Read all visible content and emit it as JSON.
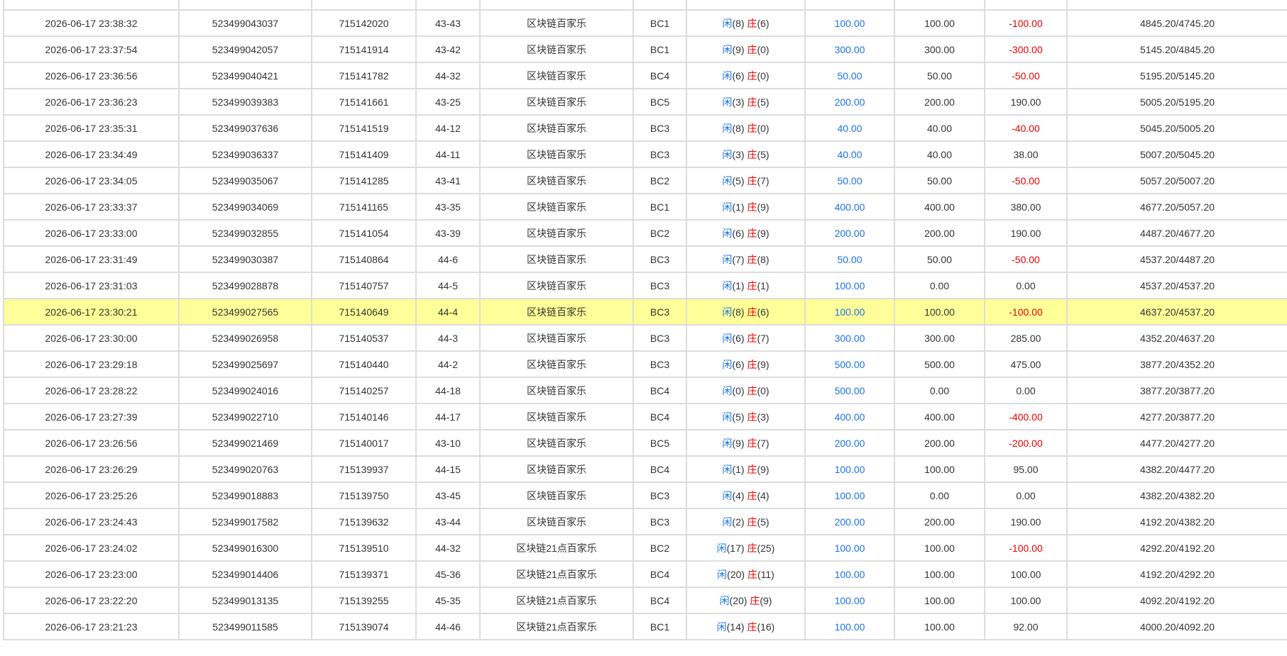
{
  "colors": {
    "player": "#1a73e8",
    "banker": "#e60000",
    "bet_amount": "#1a73e8",
    "negative": "#e60000",
    "highlight_row": "#ffff99",
    "grid": "#dcdcdc"
  },
  "labels": {
    "player": "闲",
    "banker": "庄"
  },
  "rows": [
    {
      "time": "",
      "order_no": "",
      "round_no": "",
      "shoe": "",
      "game": "",
      "table": "",
      "player_pts": "",
      "banker_pts": "",
      "bet": "",
      "valid": "",
      "win": "",
      "balance": "",
      "neg": false,
      "highlight": false,
      "partial": true
    },
    {
      "time": "2026-06-17 23:38:32",
      "order_no": "523499043037",
      "round_no": "715142020",
      "shoe": "43-43",
      "game": "区块链百家乐",
      "table": "BC1",
      "player_pts": "(8)",
      "banker_pts": "(6)",
      "bet": "100.00",
      "valid": "100.00",
      "win": "-100.00",
      "balance": "4845.20/4745.20",
      "neg": true,
      "highlight": false
    },
    {
      "time": "2026-06-17 23:37:54",
      "order_no": "523499042057",
      "round_no": "715141914",
      "shoe": "43-42",
      "game": "区块链百家乐",
      "table": "BC1",
      "player_pts": "(9)",
      "banker_pts": "(0)",
      "bet": "300.00",
      "valid": "300.00",
      "win": "-300.00",
      "balance": "5145.20/4845.20",
      "neg": true,
      "highlight": false
    },
    {
      "time": "2026-06-17 23:36:56",
      "order_no": "523499040421",
      "round_no": "715141782",
      "shoe": "44-32",
      "game": "区块链百家乐",
      "table": "BC4",
      "player_pts": "(6)",
      "banker_pts": "(0)",
      "bet": "50.00",
      "valid": "50.00",
      "win": "-50.00",
      "balance": "5195.20/5145.20",
      "neg": true,
      "highlight": false
    },
    {
      "time": "2026-06-17 23:36:23",
      "order_no": "523499039383",
      "round_no": "715141661",
      "shoe": "43-25",
      "game": "区块链百家乐",
      "table": "BC5",
      "player_pts": "(3)",
      "banker_pts": "(5)",
      "bet": "200.00",
      "valid": "200.00",
      "win": "190.00",
      "balance": "5005.20/5195.20",
      "neg": false,
      "highlight": false
    },
    {
      "time": "2026-06-17 23:35:31",
      "order_no": "523499037636",
      "round_no": "715141519",
      "shoe": "44-12",
      "game": "区块链百家乐",
      "table": "BC3",
      "player_pts": "(8)",
      "banker_pts": "(0)",
      "bet": "40.00",
      "valid": "40.00",
      "win": "-40.00",
      "balance": "5045.20/5005.20",
      "neg": true,
      "highlight": false
    },
    {
      "time": "2026-06-17 23:34:49",
      "order_no": "523499036337",
      "round_no": "715141409",
      "shoe": "44-11",
      "game": "区块链百家乐",
      "table": "BC3",
      "player_pts": "(3)",
      "banker_pts": "(5)",
      "bet": "40.00",
      "valid": "40.00",
      "win": "38.00",
      "balance": "5007.20/5045.20",
      "neg": false,
      "highlight": false
    },
    {
      "time": "2026-06-17 23:34:05",
      "order_no": "523499035067",
      "round_no": "715141285",
      "shoe": "43-41",
      "game": "区块链百家乐",
      "table": "BC2",
      "player_pts": "(5)",
      "banker_pts": "(7)",
      "bet": "50.00",
      "valid": "50.00",
      "win": "-50.00",
      "balance": "5057.20/5007.20",
      "neg": true,
      "highlight": false
    },
    {
      "time": "2026-06-17 23:33:37",
      "order_no": "523499034069",
      "round_no": "715141165",
      "shoe": "43-35",
      "game": "区块链百家乐",
      "table": "BC1",
      "player_pts": "(1)",
      "banker_pts": "(9)",
      "bet": "400.00",
      "valid": "400.00",
      "win": "380.00",
      "balance": "4677.20/5057.20",
      "neg": false,
      "highlight": false
    },
    {
      "time": "2026-06-17 23:33:00",
      "order_no": "523499032855",
      "round_no": "715141054",
      "shoe": "43-39",
      "game": "区块链百家乐",
      "table": "BC2",
      "player_pts": "(6)",
      "banker_pts": "(9)",
      "bet": "200.00",
      "valid": "200.00",
      "win": "190.00",
      "balance": "4487.20/4677.20",
      "neg": false,
      "highlight": false
    },
    {
      "time": "2026-06-17 23:31:49",
      "order_no": "523499030387",
      "round_no": "715140864",
      "shoe": "44-6",
      "game": "区块链百家乐",
      "table": "BC3",
      "player_pts": "(7)",
      "banker_pts": "(8)",
      "bet": "50.00",
      "valid": "50.00",
      "win": "-50.00",
      "balance": "4537.20/4487.20",
      "neg": true,
      "highlight": false
    },
    {
      "time": "2026-06-17 23:31:03",
      "order_no": "523499028878",
      "round_no": "715140757",
      "shoe": "44-5",
      "game": "区块链百家乐",
      "table": "BC3",
      "player_pts": "(1)",
      "banker_pts": "(1)",
      "bet": "100.00",
      "valid": "0.00",
      "win": "0.00",
      "balance": "4537.20/4537.20",
      "neg": false,
      "highlight": false
    },
    {
      "time": "2026-06-17 23:30:21",
      "order_no": "523499027565",
      "round_no": "715140649",
      "shoe": "44-4",
      "game": "区块链百家乐",
      "table": "BC3",
      "player_pts": "(8)",
      "banker_pts": "(6)",
      "bet": "100.00",
      "valid": "100.00",
      "win": "-100.00",
      "balance": "4637.20/4537.20",
      "neg": true,
      "highlight": true
    },
    {
      "time": "2026-06-17 23:30:00",
      "order_no": "523499026958",
      "round_no": "715140537",
      "shoe": "44-3",
      "game": "区块链百家乐",
      "table": "BC3",
      "player_pts": "(6)",
      "banker_pts": "(7)",
      "bet": "300.00",
      "valid": "300.00",
      "win": "285.00",
      "balance": "4352.20/4637.20",
      "neg": false,
      "highlight": false
    },
    {
      "time": "2026-06-17 23:29:18",
      "order_no": "523499025697",
      "round_no": "715140440",
      "shoe": "44-2",
      "game": "区块链百家乐",
      "table": "BC3",
      "player_pts": "(6)",
      "banker_pts": "(9)",
      "bet": "500.00",
      "valid": "500.00",
      "win": "475.00",
      "balance": "3877.20/4352.20",
      "neg": false,
      "highlight": false
    },
    {
      "time": "2026-06-17 23:28:22",
      "order_no": "523499024016",
      "round_no": "715140257",
      "shoe": "44-18",
      "game": "区块链百家乐",
      "table": "BC4",
      "player_pts": "(0)",
      "banker_pts": "(0)",
      "bet": "500.00",
      "valid": "0.00",
      "win": "0.00",
      "balance": "3877.20/3877.20",
      "neg": false,
      "highlight": false
    },
    {
      "time": "2026-06-17 23:27:39",
      "order_no": "523499022710",
      "round_no": "715140146",
      "shoe": "44-17",
      "game": "区块链百家乐",
      "table": "BC4",
      "player_pts": "(5)",
      "banker_pts": "(3)",
      "bet": "400.00",
      "valid": "400.00",
      "win": "-400.00",
      "balance": "4277.20/3877.20",
      "neg": true,
      "highlight": false
    },
    {
      "time": "2026-06-17 23:26:56",
      "order_no": "523499021469",
      "round_no": "715140017",
      "shoe": "43-10",
      "game": "区块链百家乐",
      "table": "BC5",
      "player_pts": "(9)",
      "banker_pts": "(7)",
      "bet": "200.00",
      "valid": "200.00",
      "win": "-200.00",
      "balance": "4477.20/4277.20",
      "neg": true,
      "highlight": false
    },
    {
      "time": "2026-06-17 23:26:29",
      "order_no": "523499020763",
      "round_no": "715139937",
      "shoe": "44-15",
      "game": "区块链百家乐",
      "table": "BC4",
      "player_pts": "(1)",
      "banker_pts": "(9)",
      "bet": "100.00",
      "valid": "100.00",
      "win": "95.00",
      "balance": "4382.20/4477.20",
      "neg": false,
      "highlight": false
    },
    {
      "time": "2026-06-17 23:25:26",
      "order_no": "523499018883",
      "round_no": "715139750",
      "shoe": "43-45",
      "game": "区块链百家乐",
      "table": "BC3",
      "player_pts": "(4)",
      "banker_pts": "(4)",
      "bet": "100.00",
      "valid": "0.00",
      "win": "0.00",
      "balance": "4382.20/4382.20",
      "neg": false,
      "highlight": false
    },
    {
      "time": "2026-06-17 23:24:43",
      "order_no": "523499017582",
      "round_no": "715139632",
      "shoe": "43-44",
      "game": "区块链百家乐",
      "table": "BC3",
      "player_pts": "(2)",
      "banker_pts": "(5)",
      "bet": "200.00",
      "valid": "200.00",
      "win": "190.00",
      "balance": "4192.20/4382.20",
      "neg": false,
      "highlight": false
    },
    {
      "time": "2026-06-17 23:24:02",
      "order_no": "523499016300",
      "round_no": "715139510",
      "shoe": "44-32",
      "game": "区块链21点百家乐",
      "table": "BC2",
      "player_pts": "(17)",
      "banker_pts": "(25)",
      "bet": "100.00",
      "valid": "100.00",
      "win": "-100.00",
      "balance": "4292.20/4192.20",
      "neg": true,
      "highlight": false
    },
    {
      "time": "2026-06-17 23:23:00",
      "order_no": "523499014406",
      "round_no": "715139371",
      "shoe": "45-36",
      "game": "区块链21点百家乐",
      "table": "BC4",
      "player_pts": "(20)",
      "banker_pts": "(11)",
      "bet": "100.00",
      "valid": "100.00",
      "win": "100.00",
      "balance": "4192.20/4292.20",
      "neg": false,
      "highlight": false
    },
    {
      "time": "2026-06-17 23:22:20",
      "order_no": "523499013135",
      "round_no": "715139255",
      "shoe": "45-35",
      "game": "区块链21点百家乐",
      "table": "BC4",
      "player_pts": "(20)",
      "banker_pts": "(9)",
      "bet": "100.00",
      "valid": "100.00",
      "win": "100.00",
      "balance": "4092.20/4192.20",
      "neg": false,
      "highlight": false
    },
    {
      "time": "2026-06-17 23:21:23",
      "order_no": "523499011585",
      "round_no": "715139074",
      "shoe": "44-46",
      "game": "区块链21点百家乐",
      "table": "BC1",
      "player_pts": "(14)",
      "banker_pts": "(16)",
      "bet": "100.00",
      "valid": "100.00",
      "win": "92.00",
      "balance": "4000.20/4092.20",
      "neg": false,
      "highlight": false
    }
  ]
}
